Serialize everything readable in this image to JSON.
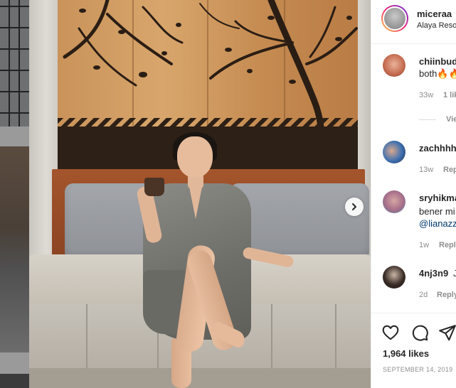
{
  "post": {
    "username": "miceraa",
    "location": "Alaya Reso",
    "likes": "1,964 likes",
    "date": "SEPTEMBER 14, 2019"
  },
  "comments": [
    {
      "user": "chiinbud",
      "text": "both🔥🔥",
      "time": "33w",
      "likes": "1 lik",
      "view_replies": "Vie"
    },
    {
      "user": "zachhhh",
      "time": "13w",
      "reply": "Repl"
    },
    {
      "user": "sryhikma",
      "text": "bener mi",
      "mention": "@lianazz",
      "time": "1w",
      "reply": "Reply"
    },
    {
      "user": "4nj3n9",
      "text_suffix": "J",
      "time": "2d",
      "reply": "Reply"
    }
  ],
  "icons": {
    "next": "chevron-right-icon",
    "like": "heart-icon",
    "comment": "speech-bubble-icon",
    "share": "paper-plane-icon"
  },
  "colors": {
    "story_ring_start": "#f9ce34",
    "story_ring_mid": "#ee2a7b",
    "story_ring_end": "#6228d7",
    "mention": "#00376b",
    "meta": "#8e8e8e"
  }
}
